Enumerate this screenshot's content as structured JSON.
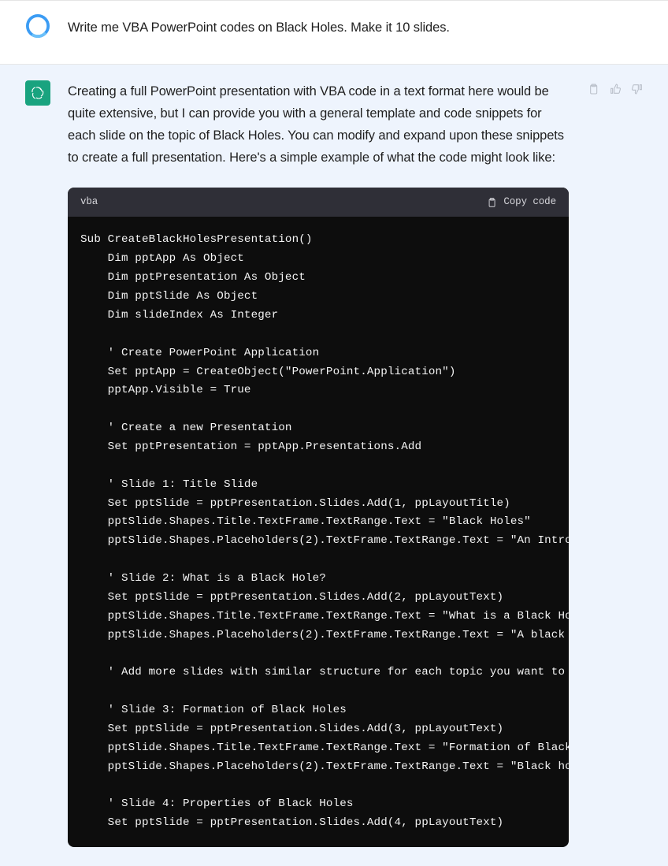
{
  "user_message": {
    "text": "Write me VBA PowerPoint codes on Black Holes. Make it 10 slides."
  },
  "assistant_message": {
    "intro": "Creating a full PowerPoint presentation with VBA code in a text format here would be quite extensive, but I can provide you with a general template and code snippets for each slide on the topic of Black Holes. You can modify and expand upon these snippets to create a full presentation. Here's a simple example of what the code might look like:"
  },
  "code_block": {
    "language": "vba",
    "copy_label": "Copy code",
    "content": "Sub CreateBlackHolesPresentation()\n    Dim pptApp As Object\n    Dim pptPresentation As Object\n    Dim pptSlide As Object\n    Dim slideIndex As Integer\n\n    ' Create PowerPoint Application\n    Set pptApp = CreateObject(\"PowerPoint.Application\")\n    pptApp.Visible = True\n\n    ' Create a new Presentation\n    Set pptPresentation = pptApp.Presentations.Add\n\n    ' Slide 1: Title Slide\n    Set pptSlide = pptPresentation.Slides.Add(1, ppLayoutTitle)\n    pptSlide.Shapes.Title.TextFrame.TextRange.Text = \"Black Holes\"\n    pptSlide.Shapes.Placeholders(2).TextFrame.TextRange.Text = \"An Introd\n\n    ' Slide 2: What is a Black Hole?\n    Set pptSlide = pptPresentation.Slides.Add(2, ppLayoutText)\n    pptSlide.Shapes.Title.TextFrame.TextRange.Text = \"What is a Black Hol\n    pptSlide.Shapes.Placeholders(2).TextFrame.TextRange.Text = \"A black h\n\n    ' Add more slides with similar structure for each topic you want to c\n\n    ' Slide 3: Formation of Black Holes\n    Set pptSlide = pptPresentation.Slides.Add(3, ppLayoutText)\n    pptSlide.Shapes.Title.TextFrame.TextRange.Text = \"Formation of Black \n    pptSlide.Shapes.Placeholders(2).TextFrame.TextRange.Text = \"Black hol\n\n    ' Slide 4: Properties of Black Holes\n    Set pptSlide = pptPresentation.Slides.Add(4, ppLayoutText)"
  },
  "icons": {
    "clipboard": "clipboard-icon",
    "thumbs_up": "thumbs-up-icon",
    "thumbs_down": "thumbs-down-icon",
    "copy": "copy-icon"
  }
}
